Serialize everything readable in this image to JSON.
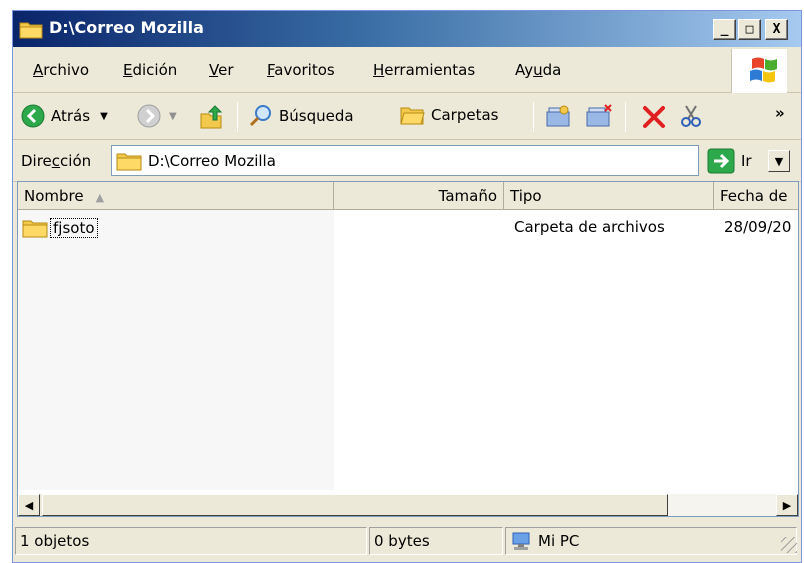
{
  "window": {
    "title": "D:\\Correo Mozilla",
    "controls": {
      "minimize": "_",
      "maximize": "□",
      "close": "X"
    }
  },
  "menu": {
    "items": [
      {
        "pre": "",
        "ul": "A",
        "post": "rchivo"
      },
      {
        "pre": "",
        "ul": "E",
        "post": "dición"
      },
      {
        "pre": "",
        "ul": "V",
        "post": "er"
      },
      {
        "pre": "",
        "ul": "F",
        "post": "avoritos"
      },
      {
        "pre": "",
        "ul": "H",
        "post": "erramientas"
      },
      {
        "pre": "Ay",
        "ul": "u",
        "post": "da"
      }
    ]
  },
  "toolbar": {
    "back_label": "Atrás",
    "search_label": "Búsqueda",
    "folders_label": "Carpetas",
    "more": "»"
  },
  "address": {
    "label_pre": "Dire",
    "label_ul": "c",
    "label_post": "ción",
    "value": "D:\\Correo Mozilla",
    "go_label": "Ir"
  },
  "list": {
    "columns": [
      "Nombre",
      "Tamaño",
      "Tipo",
      "Fecha de"
    ],
    "rows": [
      {
        "name": "fjsoto",
        "size": "",
        "type": "Carpeta de archivos",
        "date": "28/09/20"
      }
    ]
  },
  "status": {
    "count": "1 objetos",
    "size": "0 bytes",
    "location": "Mi PC"
  },
  "colors": {
    "title_start": "#0a246a",
    "title_end": "#a6caf0",
    "chrome": "#ece9d8",
    "folder": "#f2c94c",
    "delete_red": "#e02020",
    "go_green": "#2da84a"
  }
}
